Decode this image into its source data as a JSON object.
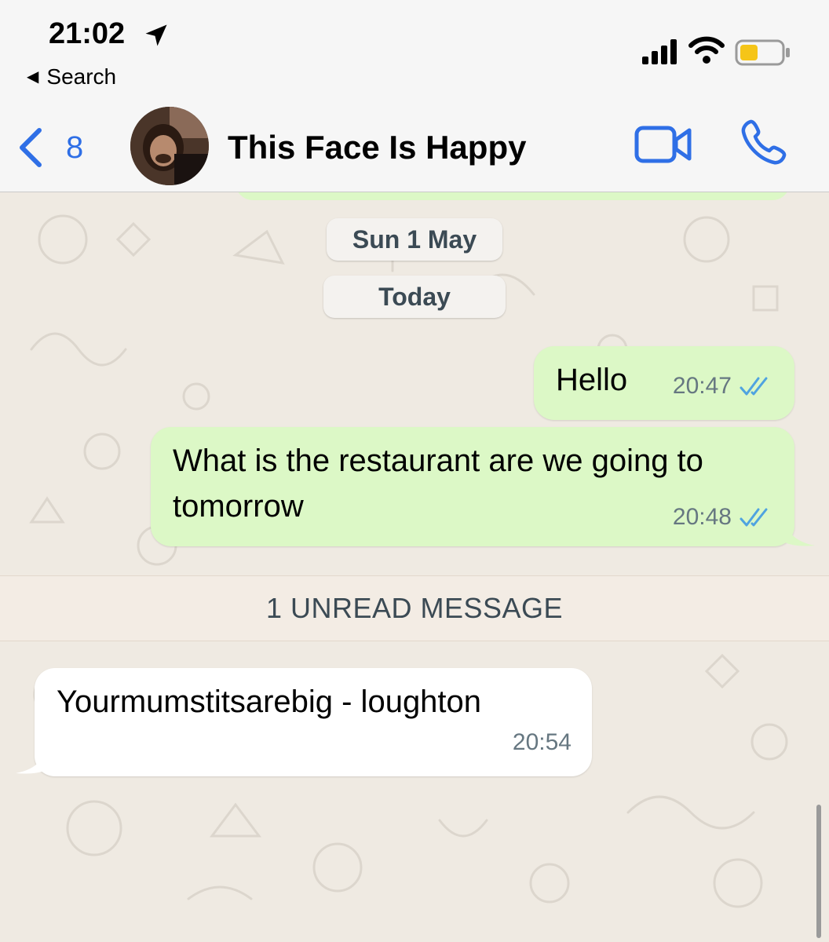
{
  "status_bar": {
    "time": "21:02",
    "back_app": "Search"
  },
  "header": {
    "back_count": "8",
    "contact_name": "This Face Is Happy",
    "accent_color": "#2f6fe6"
  },
  "date_pills": [
    "Sun 1 May",
    "Today"
  ],
  "messages": [
    {
      "direction": "out",
      "text": "Hello",
      "time": "20:47",
      "status": "read"
    },
    {
      "direction": "out",
      "text": "What is the restaurant are we going to tomorrow",
      "time": "20:48",
      "status": "read"
    },
    {
      "direction": "in",
      "text": "Yourmumstitsarebig - loughton",
      "time": "20:54"
    }
  ],
  "unread_banner": "1 UNREAD MESSAGE",
  "colors": {
    "outgoing_bubble": "#dcf8c6",
    "incoming_bubble": "#ffffff",
    "wallpaper": "#efeae2",
    "read_ticks": "#4fa3e0"
  }
}
